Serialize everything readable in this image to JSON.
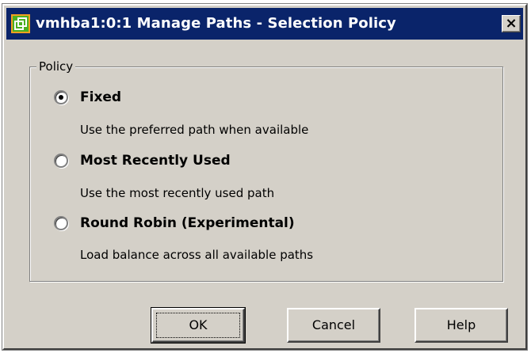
{
  "window": {
    "title": "vmhba1:0:1 Manage Paths - Selection Policy",
    "close_label": "×",
    "icon": "vmware-icon"
  },
  "policy": {
    "legend": "Policy",
    "selected": "fixed",
    "options": [
      {
        "id": "fixed",
        "label": "Fixed",
        "description": "Use the preferred path when available",
        "checked": true
      },
      {
        "id": "most-recently-used",
        "label": "Most Recently Used",
        "description": "Use the most recently used path",
        "checked": false
      },
      {
        "id": "round-robin",
        "label": "Round Robin (Experimental)",
        "description": "Load balance across all available paths",
        "checked": false
      }
    ]
  },
  "buttons": {
    "ok": "OK",
    "cancel": "Cancel",
    "help": "Help"
  },
  "colors": {
    "titlebar": "#0a246a",
    "face": "#d4d0c8",
    "icon_green": "#4caf22",
    "icon_orange": "#f0a020"
  }
}
